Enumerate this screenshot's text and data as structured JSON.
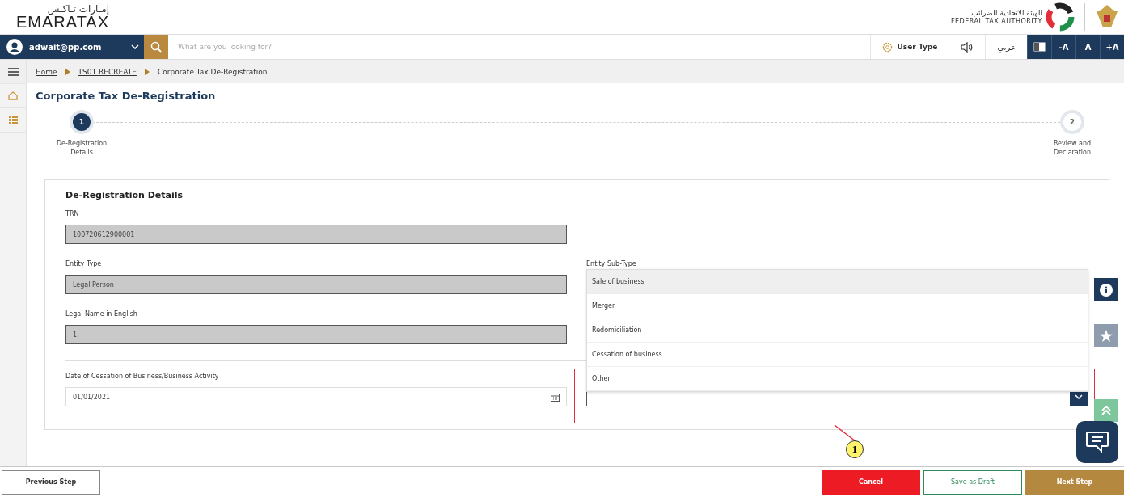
{
  "header": {
    "logo_arabic": "إمـارات تـاكـس",
    "logo_text": "EMARATAX",
    "authority_arabic": "الهيئة الاتحادية للضرائب",
    "authority_english": "FEDERAL TAX AUTHORITY"
  },
  "topbar": {
    "user": "adwait@pp.com",
    "search_placeholder": "What are you looking for?",
    "user_type": "User Type",
    "language": "عربي",
    "font_buttons": [
      "-A",
      "A",
      "+A"
    ]
  },
  "breadcrumb": [
    {
      "label": "Home",
      "link": true
    },
    {
      "label": "TS01 RECREATE",
      "link": true
    },
    {
      "label": "Corporate Tax De-Registration",
      "link": false
    }
  ],
  "page_title": "Corporate Tax De-Registration",
  "steps": [
    {
      "number": "1",
      "label": "De-Registration Details",
      "selected": true
    },
    {
      "number": "2",
      "label": "Review and Declaration",
      "selected": false
    }
  ],
  "section": {
    "title": "De-Registration Details",
    "trn": {
      "label": "TRN",
      "value": "100720612900001",
      "disabled": true
    },
    "entity_type": {
      "label": "Entity Type",
      "value": "Legal Person",
      "disabled": true
    },
    "entity_sub_type": {
      "label": "Entity Sub-Type"
    },
    "legal_name": {
      "label": "Legal Name in English",
      "value": "1",
      "disabled": true
    },
    "cessation_date": {
      "label": "Date of Cessation of Business/Business Activity",
      "value": "01/01/2021",
      "disabled": false
    },
    "dropdown": {
      "expanded": true,
      "options": [
        {
          "label": "Sale of business",
          "selected": true
        },
        {
          "label": "Merger",
          "selected": false
        },
        {
          "label": "Redomiciliation",
          "selected": false
        },
        {
          "label": "Cessation of business",
          "selected": false
        },
        {
          "label": "Other",
          "selected": false
        }
      ]
    }
  },
  "annotation": {
    "number": "1"
  },
  "footer": {
    "buttons": [
      {
        "label": "Previous Step",
        "kind": "outline"
      },
      {
        "label": "Cancel",
        "kind": "danger"
      },
      {
        "label": "Save as Draft",
        "kind": "draft"
      },
      {
        "label": "Next Step",
        "kind": "primary"
      }
    ]
  }
}
